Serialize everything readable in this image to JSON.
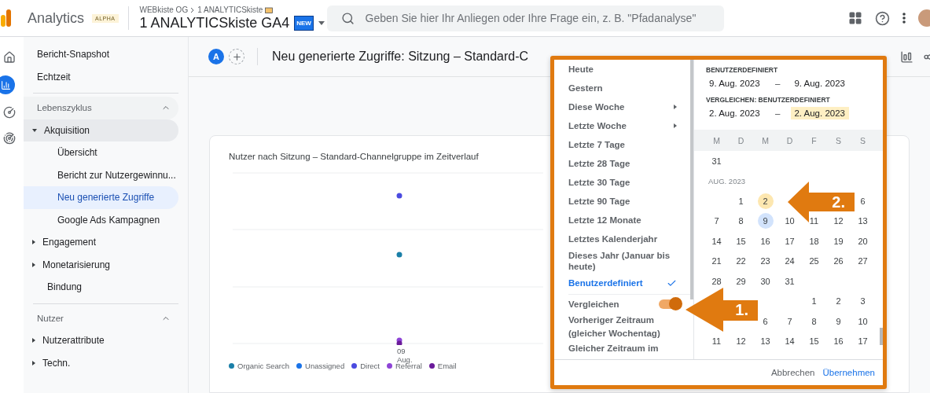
{
  "header": {
    "product": "Analytics",
    "product_badge": "ALPHA",
    "breadcrumb": [
      "WEBkiste OG",
      "1 ANALYTICSkiste"
    ],
    "property": "1 ANALYTICSkiste GA4",
    "property_badge": "NEW",
    "search": {
      "placeholder": "Geben Sie hier Ihr Anliegen oder Ihre Frage ein, z. B. \"Pfadanalyse\""
    }
  },
  "rail": [
    {
      "kind": "home",
      "selected": false
    },
    {
      "kind": "reports",
      "selected": true
    },
    {
      "kind": "explore",
      "selected": false
    },
    {
      "kind": "advertising",
      "selected": false
    }
  ],
  "sidebar": {
    "top": [
      {
        "label": "Bericht-Snapshot"
      },
      {
        "label": "Echtzeit"
      }
    ],
    "sections": [
      {
        "title": "Lebenszyklus",
        "expanded": true,
        "items": [
          {
            "label": "Akquisition",
            "expanded": true,
            "children": [
              {
                "label": "Übersicht",
                "selected": false
              },
              {
                "label": "Bericht zur Nutzergewinnu...",
                "selected": false
              },
              {
                "label": "Neu generierte Zugriffe",
                "selected": true
              },
              {
                "label": "Google Ads Kampagnen",
                "selected": false
              }
            ]
          },
          {
            "label": "Engagement",
            "expanded": false
          },
          {
            "label": "Monetarisierung",
            "expanded": false
          },
          {
            "label": "Bindung"
          }
        ]
      },
      {
        "title": "Nutzer",
        "expanded": true,
        "items": [
          {
            "label": "Nutzerattribute",
            "expanded": false
          },
          {
            "label": "Techn.",
            "expanded": false
          }
        ]
      }
    ]
  },
  "toolbar": {
    "comparison": "A",
    "title": "Neu generierte Zugriffe: Sitzung – Standard-C"
  },
  "chart_card": {
    "title": "Nutzer nach Sitzung – Standard-Channelgruppe im Zeitverlauf",
    "x_tick": "09 Aug.",
    "legend": [
      {
        "name": "Organic Search",
        "color": "#1a7fa8"
      },
      {
        "name": "Unassigned",
        "color": "#1a73e8"
      },
      {
        "name": "Direct",
        "color": "#4b4be0"
      },
      {
        "name": "Referral",
        "color": "#8e44d6"
      },
      {
        "name": "Email",
        "color": "#6a1b9a"
      }
    ]
  },
  "date_picker": {
    "presets": [
      {
        "label": "Heute",
        "submenu": false,
        "selected": false
      },
      {
        "label": "Gestern",
        "submenu": false,
        "selected": false
      },
      {
        "label": "Diese Woche",
        "submenu": true,
        "selected": false
      },
      {
        "label": "Letzte Woche",
        "submenu": true,
        "selected": false
      },
      {
        "label": "Letzte 7 Tage",
        "submenu": false,
        "selected": false
      },
      {
        "label": "Letzte 28 Tage",
        "submenu": false,
        "selected": false
      },
      {
        "label": "Letzte 30 Tage",
        "submenu": false,
        "selected": false
      },
      {
        "label": "Letzte 90 Tage",
        "submenu": false,
        "selected": false
      },
      {
        "label": "Letzte 12 Monate",
        "submenu": false,
        "selected": false
      },
      {
        "label": "Letztes Kalenderjahr",
        "submenu": false,
        "selected": false
      },
      {
        "label": "Dieses Jahr (Januar bis heute)",
        "submenu": false,
        "selected": false
      },
      {
        "label": "Benutzerdefiniert",
        "submenu": false,
        "selected": true
      }
    ],
    "compare": {
      "label": "Vergleichen",
      "on": true,
      "options": [
        "Vorheriger Zeitraum (gleicher Wochentag)",
        "Gleicher Zeitraum im"
      ]
    },
    "range": {
      "label": "BENUTZERDEFINIERT",
      "start": "9. Aug. 2023",
      "separator": "–",
      "end": "9. Aug. 2023",
      "focused": false
    },
    "compare_range": {
      "label": "VERGLEICHEN: BENUTZERDEFINIERT",
      "start": "2. Aug. 2023",
      "separator": "–",
      "end": "2. Aug. 2023",
      "focused": true
    },
    "weekdays": [
      "M",
      "D",
      "M",
      "D",
      "F",
      "S",
      "S"
    ],
    "rows": [
      {
        "kind": "week",
        "days": [
          {
            "kind": "day",
            "d": "31",
            "selected": false,
            "compare": false
          }
        ]
      },
      {
        "kind": "month",
        "label": "AUG. 2023"
      },
      {
        "kind": "week",
        "days": [
          {
            "kind": "empty"
          },
          {
            "kind": "day",
            "d": "1",
            "selected": false,
            "compare": false
          },
          {
            "kind": "day",
            "d": "2",
            "selected": false,
            "compare": true
          },
          {
            "kind": "empty"
          },
          {
            "kind": "empty"
          },
          {
            "kind": "empty"
          },
          {
            "kind": "day",
            "d": "6",
            "selected": false,
            "compare": false
          }
        ]
      },
      {
        "kind": "week",
        "days": [
          {
            "kind": "day",
            "d": "7",
            "selected": false,
            "compare": false
          },
          {
            "kind": "day",
            "d": "8",
            "selected": false,
            "compare": false
          },
          {
            "kind": "day",
            "d": "9",
            "selected": true,
            "compare": false
          },
          {
            "kind": "day",
            "d": "10",
            "selected": false,
            "compare": false
          },
          {
            "kind": "day",
            "d": "11",
            "selected": false,
            "compare": false
          },
          {
            "kind": "day",
            "d": "12",
            "selected": false,
            "compare": false
          },
          {
            "kind": "day",
            "d": "13",
            "selected": false,
            "compare": false
          }
        ]
      },
      {
        "kind": "week",
        "days": [
          {
            "kind": "day",
            "d": "14",
            "selected": false,
            "compare": false
          },
          {
            "kind": "day",
            "d": "15",
            "selected": false,
            "compare": false
          },
          {
            "kind": "day",
            "d": "16",
            "selected": false,
            "compare": false
          },
          {
            "kind": "day",
            "d": "17",
            "selected": false,
            "compare": false
          },
          {
            "kind": "day",
            "d": "18",
            "selected": false,
            "compare": false
          },
          {
            "kind": "day",
            "d": "19",
            "selected": false,
            "compare": false
          },
          {
            "kind": "day",
            "d": "20",
            "selected": false,
            "compare": false
          }
        ]
      },
      {
        "kind": "week",
        "days": [
          {
            "kind": "day",
            "d": "21",
            "selected": false,
            "compare": false
          },
          {
            "kind": "day",
            "d": "22",
            "selected": false,
            "compare": false
          },
          {
            "kind": "day",
            "d": "23",
            "selected": false,
            "compare": false
          },
          {
            "kind": "day",
            "d": "24",
            "selected": false,
            "compare": false
          },
          {
            "kind": "day",
            "d": "25",
            "selected": false,
            "compare": false
          },
          {
            "kind": "day",
            "d": "26",
            "selected": false,
            "compare": false
          },
          {
            "kind": "day",
            "d": "27",
            "selected": false,
            "compare": false
          }
        ]
      },
      {
        "kind": "week",
        "days": [
          {
            "kind": "day",
            "d": "28",
            "selected": false,
            "compare": false
          },
          {
            "kind": "day",
            "d": "29",
            "selected": false,
            "compare": false
          },
          {
            "kind": "day",
            "d": "30",
            "selected": false,
            "compare": false
          },
          {
            "kind": "day",
            "d": "31",
            "selected": false,
            "compare": false
          }
        ]
      },
      {
        "kind": "week",
        "days": [
          {
            "kind": "empty"
          },
          {
            "kind": "empty"
          },
          {
            "kind": "empty"
          },
          {
            "kind": "empty"
          },
          {
            "kind": "day",
            "d": "1",
            "selected": false,
            "compare": false
          },
          {
            "kind": "day",
            "d": "2",
            "selected": false,
            "compare": false
          },
          {
            "kind": "day",
            "d": "3",
            "selected": false,
            "compare": false
          }
        ]
      },
      {
        "kind": "week",
        "days": [
          {
            "kind": "empty"
          },
          {
            "kind": "empty"
          },
          {
            "kind": "day",
            "d": "6",
            "selected": false,
            "compare": false
          },
          {
            "kind": "day",
            "d": "7",
            "selected": false,
            "compare": false
          },
          {
            "kind": "day",
            "d": "8",
            "selected": false,
            "compare": false
          },
          {
            "kind": "day",
            "d": "9",
            "selected": false,
            "compare": false
          },
          {
            "kind": "day",
            "d": "10",
            "selected": false,
            "compare": false
          }
        ]
      },
      {
        "kind": "week",
        "days": [
          {
            "kind": "day",
            "d": "11",
            "selected": false,
            "compare": false
          },
          {
            "kind": "day",
            "d": "12",
            "selected": false,
            "compare": false
          },
          {
            "kind": "day",
            "d": "13",
            "selected": false,
            "compare": false
          },
          {
            "kind": "day",
            "d": "14",
            "selected": false,
            "compare": false
          },
          {
            "kind": "day",
            "d": "15",
            "selected": false,
            "compare": false
          },
          {
            "kind": "day",
            "d": "16",
            "selected": false,
            "compare": false
          },
          {
            "kind": "day",
            "d": "17",
            "selected": false,
            "compare": false
          }
        ]
      }
    ],
    "buttons": [
      {
        "label": "Abbrechen",
        "primary": false
      },
      {
        "label": "Übernehmen",
        "primary": true
      }
    ]
  },
  "annotations": [
    {
      "label": "1."
    },
    {
      "label": "2."
    }
  ]
}
